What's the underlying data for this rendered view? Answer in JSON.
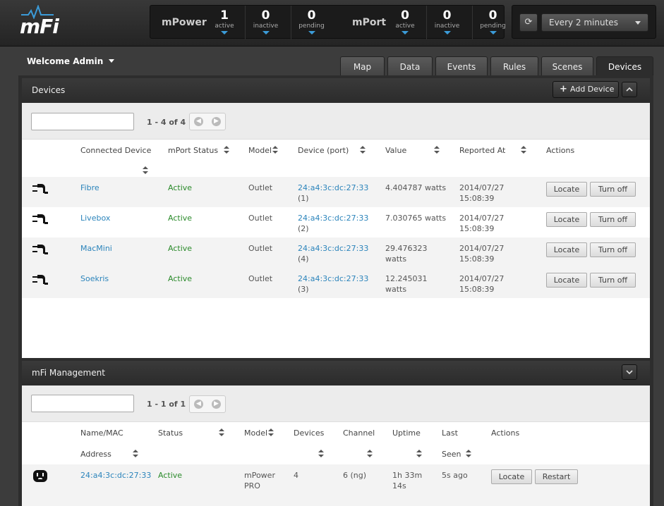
{
  "logo": {
    "text": "mFi"
  },
  "stats": {
    "mpower": {
      "label": "mPower",
      "active": "1",
      "active_label": "active",
      "inactive": "0",
      "inactive_label": "inactive",
      "pending": "0",
      "pending_label": "pending"
    },
    "mport": {
      "label": "mPort",
      "active": "0",
      "active_label": "active",
      "inactive": "0",
      "inactive_label": "inactive",
      "pending": "0",
      "pending_label": "pending"
    }
  },
  "refresh": {
    "interval": "Every 2 minutes"
  },
  "user": {
    "welcome": "Welcome Admin"
  },
  "tabs": [
    "Map",
    "Data",
    "Events",
    "Rules",
    "Scenes",
    "Devices"
  ],
  "devices_panel": {
    "title": "Devices",
    "add_button": "Add Device",
    "pager": "1 - 4 of 4",
    "columns": [
      "Connected Device",
      "mPort Status",
      "Model",
      "Device (port)",
      "Value",
      "Reported At",
      "Actions"
    ],
    "rows": [
      {
        "name": "Fibre",
        "status": "Active",
        "model": "Outlet",
        "device": "24:a4:3c:dc:27:33",
        "port": "(1)",
        "value": "4.404787 watts",
        "value2": "",
        "date": "2014/07/27",
        "time": "15:08:39",
        "locate": "Locate",
        "toggle": "Turn off"
      },
      {
        "name": "Livebox",
        "status": "Active",
        "model": "Outlet",
        "device": "24:a4:3c:dc:27:33",
        "port": "(2)",
        "value": "7.030765 watts",
        "value2": "",
        "date": "2014/07/27",
        "time": "15:08:39",
        "locate": "Locate",
        "toggle": "Turn off"
      },
      {
        "name": "MacMini",
        "status": "Active",
        "model": "Outlet",
        "device": "24:a4:3c:dc:27:33",
        "port": "(4)",
        "value": "29.476323",
        "value2": "watts",
        "date": "2014/07/27",
        "time": "15:08:39",
        "locate": "Locate",
        "toggle": "Turn off"
      },
      {
        "name": "Soekris",
        "status": "Active",
        "model": "Outlet",
        "device": "24:a4:3c:dc:27:33",
        "port": "(3)",
        "value": "12.245031",
        "value2": "watts",
        "date": "2014/07/27",
        "time": "15:08:39",
        "locate": "Locate",
        "toggle": "Turn off"
      }
    ]
  },
  "mgmt_panel": {
    "title": "mFi Management",
    "pager": "1 - 1 of 1",
    "columns": {
      "name1": "Name/MAC",
      "name2": "Address",
      "status": "Status",
      "model": "Model",
      "devices": "Devices",
      "channel": "Channel",
      "uptime": "Uptime",
      "last1": "Last",
      "last2": "Seen",
      "actions": "Actions"
    },
    "rows": [
      {
        "mac": "24:a4:3c:dc:27:33",
        "status": "Active",
        "model1": "mPower",
        "model2": "PRO",
        "devices": "4",
        "channel": "6 (ng)",
        "uptime1": "1h 33m",
        "uptime2": "14s",
        "last_seen": "5s ago",
        "locate": "Locate",
        "restart": "Restart"
      }
    ]
  }
}
